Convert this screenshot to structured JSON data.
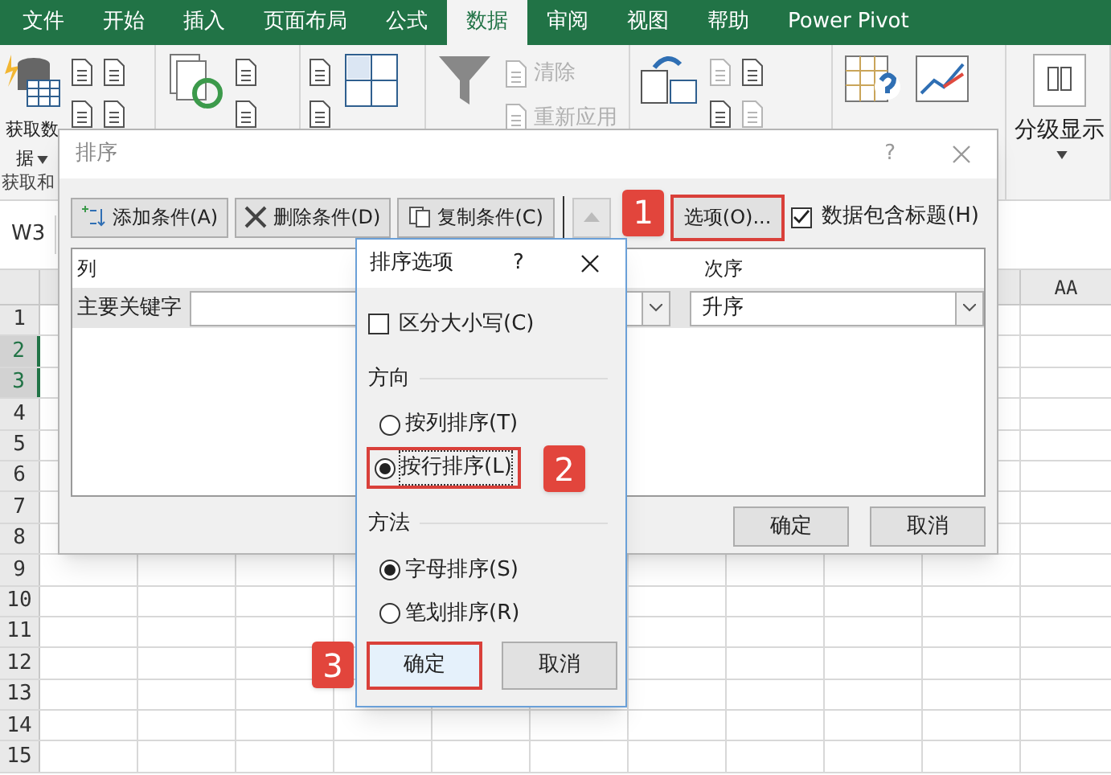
{
  "ribbon_tabs": [
    {
      "label": "文件",
      "selected": false
    },
    {
      "label": "开始",
      "selected": false
    },
    {
      "label": "插入",
      "selected": false
    },
    {
      "label": "页面布局",
      "selected": false
    },
    {
      "label": "公式",
      "selected": false
    },
    {
      "label": "数据",
      "selected": true
    },
    {
      "label": "审阅",
      "selected": false
    },
    {
      "label": "视图",
      "selected": false
    },
    {
      "label": "帮助",
      "selected": false
    },
    {
      "label": "Power Pivot",
      "selected": false
    }
  ],
  "ribbon_groups": [
    {
      "label": "获取和",
      "items": [
        {
          "kind": "large",
          "label": "获取数",
          "label_2": "据",
          "caret": true
        },
        {
          "kind": "stack",
          "items": [
            {
              "disabled": false
            },
            {
              "disabled": false
            }
          ]
        },
        {
          "kind": "stack",
          "items": [
            {
              "disabled": false
            },
            {
              "disabled": false
            }
          ]
        }
      ]
    },
    {
      "items": [
        {
          "kind": "large"
        },
        {
          "kind": "stack",
          "items": [
            {
              "disabled": false
            },
            {
              "disabled": false
            }
          ]
        }
      ]
    },
    {
      "items": [
        {
          "kind": "stack",
          "items": [
            {
              "disabled": false
            },
            {
              "disabled": false
            }
          ]
        },
        {
          "kind": "large"
        }
      ]
    },
    {
      "items": [
        {
          "kind": "large"
        },
        {
          "kind": "stack",
          "items": [
            {
              "label": "清除",
              "disabled": true
            },
            {
              "label": "重新应用",
              "disabled": true
            }
          ]
        }
      ]
    },
    {
      "items": [
        {
          "kind": "large"
        },
        {
          "kind": "stack",
          "items": [
            {
              "disabled": true
            },
            {
              "disabled": false
            }
          ]
        },
        {
          "kind": "stack",
          "items": [
            {
              "disabled": false
            },
            {
              "disabled": true
            }
          ]
        }
      ]
    },
    {
      "items": [
        {
          "kind": "large"
        },
        {
          "kind": "large"
        }
      ]
    },
    {
      "items": [
        {
          "kind": "large",
          "label": "分级显示",
          "caret": true
        }
      ]
    }
  ],
  "sheet": {
    "name_box": "W3",
    "column_header": "AA",
    "rows": [
      {
        "label": "1",
        "selected": false
      },
      {
        "label": "2",
        "selected": true
      },
      {
        "label": "3",
        "selected": true
      },
      {
        "label": "4",
        "selected": false
      },
      {
        "label": "5",
        "selected": false
      },
      {
        "label": "6",
        "selected": false
      },
      {
        "label": "7",
        "selected": false
      },
      {
        "label": "8",
        "selected": false
      },
      {
        "label": "9",
        "selected": false
      },
      {
        "label": "10",
        "selected": false
      },
      {
        "label": "11",
        "selected": false
      },
      {
        "label": "12",
        "selected": false
      },
      {
        "label": "13",
        "selected": false
      },
      {
        "label": "14",
        "selected": false
      },
      {
        "label": "15",
        "selected": false
      }
    ]
  },
  "sort_dialog": {
    "title": "排序",
    "help": "?",
    "toolbar": [
      {
        "kind": "add",
        "label": "添加条件(A)"
      },
      {
        "kind": "delete",
        "label": "删除条件(D)"
      },
      {
        "kind": "copy",
        "label": "复制条件(C)"
      },
      {
        "kind": "up",
        "disabled": true
      }
    ],
    "options_button": {
      "label": "选项(O)...",
      "step": "1"
    },
    "header_checkbox": {
      "label": "数据包含标题(H)",
      "checked": true
    },
    "columns": [
      "列",
      "次序"
    ],
    "rows": [
      {
        "label": "主要关键字",
        "order": "升序",
        "selected": true
      }
    ],
    "buttons": [
      "确定",
      "取消"
    ]
  },
  "options_dialog": {
    "title": "排序选项",
    "help": "?",
    "case_checkbox": {
      "label": "区分大小写(C)",
      "checked": false
    },
    "sections": [
      {
        "title": "方向",
        "options": [
          {
            "label": "按列排序(T)",
            "selected": false,
            "focused": false
          },
          {
            "label": "按行排序(L)",
            "selected": true,
            "focused": true,
            "step": "2"
          }
        ]
      },
      {
        "title": "方法",
        "options": [
          {
            "label": "字母排序(S)",
            "selected": true,
            "focused": false
          },
          {
            "label": "笔划排序(R)",
            "selected": false,
            "focused": false
          }
        ]
      }
    ],
    "buttons": [
      {
        "label": "确定",
        "default": true,
        "step": "3"
      },
      {
        "label": "取消",
        "default": false
      }
    ]
  }
}
